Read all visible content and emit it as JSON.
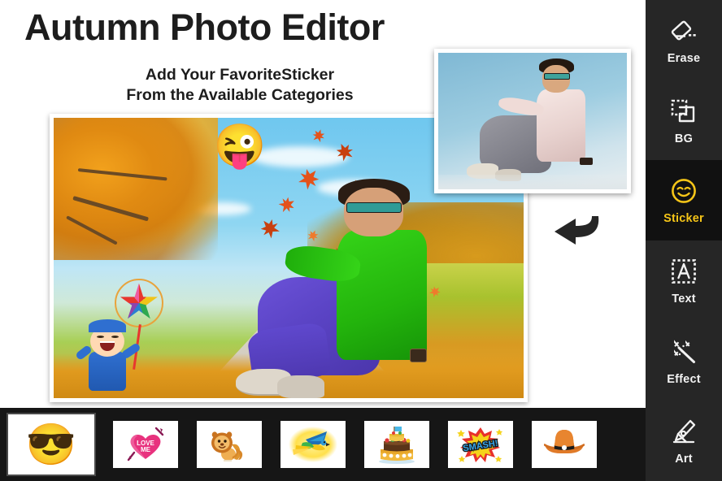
{
  "header": {
    "title": "Autumn Photo Editor",
    "subtitle_line1": "Add Your FavoriteSticker",
    "subtitle_line2": "From the Available Categories"
  },
  "canvas": {
    "name": "edited-photo",
    "description": "Man in green shirt and purple jeans sitting in an autumn park",
    "stickers_applied": [
      {
        "name": "winking-tongue-emoji",
        "glyph": "😜"
      },
      {
        "name": "kite-boy-sticker",
        "glyph": ""
      }
    ]
  },
  "inset": {
    "name": "original-photo",
    "description": "Man in pink shirt and grey jeans against blue sky"
  },
  "arrow": {
    "name": "curved-back-arrow",
    "color": "#262626"
  },
  "sidebar": {
    "active": "Sticker",
    "accent_color": "#f5c518",
    "background": "#262626",
    "active_background": "#111111",
    "items": [
      {
        "label": "Erase",
        "icon": "eraser-icon",
        "active": false
      },
      {
        "label": "BG",
        "icon": "background-icon",
        "active": false
      },
      {
        "label": "Sticker",
        "icon": "smiley-icon",
        "active": true
      },
      {
        "label": "Text",
        "icon": "text-a-icon",
        "active": false
      },
      {
        "label": "Effect",
        "icon": "magic-wand-icon",
        "active": false
      },
      {
        "label": "Art",
        "icon": "fountain-pen-icon",
        "active": false
      }
    ]
  },
  "sticker_bar": {
    "background": "#161616",
    "selected_index": 0,
    "items": [
      {
        "name": "cool-sunglasses-emoji",
        "label": "Cool Emoji",
        "glyph": "😎"
      },
      {
        "name": "love-me-heart",
        "label": "Love Me Heart",
        "text": "LOVE ME"
      },
      {
        "name": "lion-sticker",
        "label": "Lion",
        "glyph": "🦁"
      },
      {
        "name": "parrot-sticker",
        "label": "Parrot",
        "glyph": "🦜"
      },
      {
        "name": "birthday-cake-sticker",
        "label": "Birthday Cake",
        "glyph": "🎂"
      },
      {
        "name": "smash-comic-sticker",
        "label": "Smash",
        "text": "SMASH!"
      },
      {
        "name": "cowboy-hat-sticker",
        "label": "Cowboy Hat",
        "glyph": "🤠"
      }
    ]
  }
}
